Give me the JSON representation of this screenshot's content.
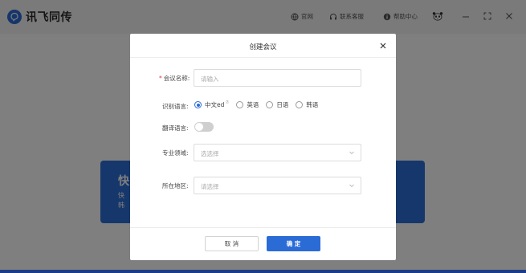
{
  "app": {
    "name": "讯飞同传",
    "colors": {
      "accent": "#2a6bd6",
      "card": "#2d6fd6",
      "required": "#e4393c"
    }
  },
  "titlebar": {
    "links": [
      {
        "icon": "globe-icon",
        "label": "官网"
      },
      {
        "icon": "headset-icon",
        "label": "联系客服"
      },
      {
        "icon": "info-icon",
        "label": "帮助中心"
      }
    ],
    "icons": {
      "avatar": "panda-avatar-icon",
      "minimize": "minimize-icon",
      "maximize": "maximize-icon",
      "close": "close-icon"
    }
  },
  "background": {
    "card_title": "快",
    "card_line1": "快",
    "card_line2": "韩"
  },
  "modal": {
    "title": "创建会议",
    "name_label": "会议名称:",
    "name_placeholder": "请输入",
    "lang_label": "识别语言:",
    "languages": [
      {
        "label": "中文ed",
        "selected": true,
        "sup": "⑦"
      },
      {
        "label": "英语",
        "selected": false
      },
      {
        "label": "日语",
        "selected": false
      },
      {
        "label": "韩语",
        "selected": false
      }
    ],
    "translate_label": "翻译语言:",
    "translate_enabled": false,
    "domain_label": "专业领域:",
    "domain_placeholder": "选选择",
    "region_label": "所在地区:",
    "region_placeholder": "请选择",
    "cancel_label": "取 消",
    "ok_label": "确 定"
  }
}
